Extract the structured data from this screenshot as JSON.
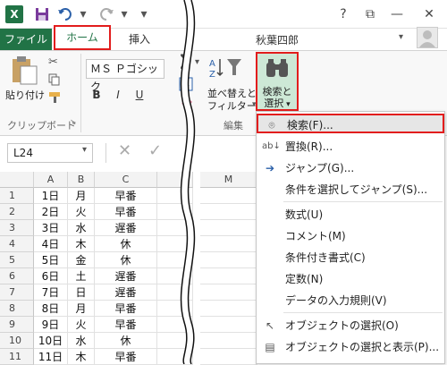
{
  "titlebar": {
    "app_logo": "X",
    "help": "?",
    "restore": "⧉",
    "minimize": "—",
    "close": "✕"
  },
  "tabs": {
    "file": "ファイル",
    "home": "ホーム",
    "insert": "挿入"
  },
  "user": {
    "name": "秋葉四郎"
  },
  "ribbon": {
    "paste_label": "貼り付け",
    "clipboard_group": "クリップボード",
    "font_name": "ＭＳ Ｐゴシック",
    "bold": "B",
    "italic": "I",
    "underline": "U",
    "sort_label_1": "並べ替えと",
    "sort_label_2": "フィルター",
    "editing_group": "編集",
    "find_label_1": "検索と",
    "find_label_2": "選択"
  },
  "namebox": {
    "value": "L24"
  },
  "columns": [
    "A",
    "B",
    "C"
  ],
  "right_column": "M",
  "rows": [
    {
      "n": "1",
      "a": "1日",
      "b": "月",
      "c": "早番"
    },
    {
      "n": "2",
      "a": "2日",
      "b": "火",
      "c": "早番"
    },
    {
      "n": "3",
      "a": "3日",
      "b": "水",
      "c": "遅番"
    },
    {
      "n": "4",
      "a": "4日",
      "b": "木",
      "c": "休"
    },
    {
      "n": "5",
      "a": "5日",
      "b": "金",
      "c": "休"
    },
    {
      "n": "6",
      "a": "6日",
      "b": "土",
      "c": "遅番"
    },
    {
      "n": "7",
      "a": "7日",
      "b": "日",
      "c": "遅番"
    },
    {
      "n": "8",
      "a": "8日",
      "b": "月",
      "c": "早番"
    },
    {
      "n": "9",
      "a": "9日",
      "b": "火",
      "c": "早番"
    },
    {
      "n": "10",
      "a": "10日",
      "b": "水",
      "c": "休"
    },
    {
      "n": "11",
      "a": "11日",
      "b": "木",
      "c": "早番"
    }
  ],
  "menu": {
    "find": "検索(F)...",
    "replace": "置換(R)...",
    "goto": "ジャンプ(G)...",
    "goto_special": "条件を選択してジャンプ(S)...",
    "formulas": "数式(U)",
    "comments": "コメント(M)",
    "conditional_formatting": "条件付き書式(C)",
    "constants": "定数(N)",
    "data_validation": "データの入力規則(V)",
    "select_objects": "オブジェクトの選択(O)",
    "selection_pane": "オブジェクトの選択と表示(P)..."
  }
}
